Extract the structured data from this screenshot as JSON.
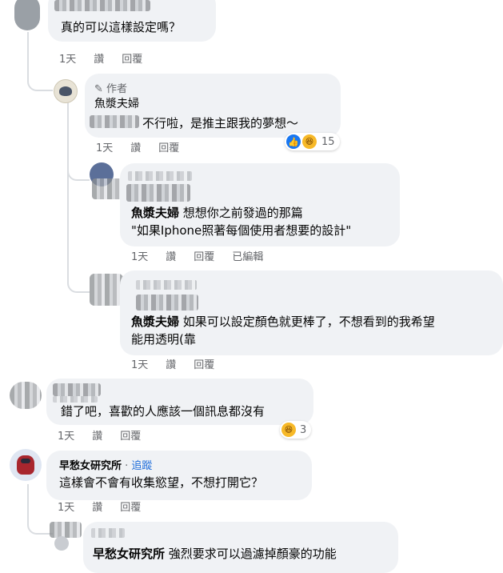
{
  "c1": {
    "text": "真的可以這樣設定嗎？",
    "meta": [
      "1天",
      "讚",
      "回覆"
    ]
  },
  "c2": {
    "badge": "作者",
    "name": "魚漿夫婦",
    "text": "不行啦，是推主跟我的夢想～",
    "meta": [
      "1天",
      "讚",
      "回覆"
    ],
    "reaction_count": "15"
  },
  "c3": {
    "mention": "魚漿夫婦",
    "text1": " 想想你之前發過的那篇",
    "text2": "\"如果Iphone照著每個使用者想要的設計\"",
    "meta": [
      "1天",
      "讚",
      "回覆",
      "已編輯"
    ]
  },
  "c4": {
    "mention": "魚漿夫婦",
    "text1": " 如果可以設定顏色就更棒了，不想看到的我希望",
    "text2": "能用透明(靠",
    "meta": [
      "1天",
      "讚",
      "回覆"
    ]
  },
  "c5": {
    "text": "錯了吧，喜歡的人應該一個訊息都沒有",
    "meta": [
      "1天",
      "讚",
      "回覆"
    ],
    "reaction_count": "3"
  },
  "c6": {
    "name": "早愁女研究所",
    "sep": " · ",
    "follow": "追蹤",
    "text": "這樣會不會有收集慾望，不想打開它？",
    "meta": [
      "1天",
      "讚",
      "回覆"
    ]
  },
  "c7": {
    "mention": "早愁女研究所",
    "text": " 強烈要求可以過濾掉顏豪的功能"
  },
  "colors": {
    "bubble": "#f0f2f5",
    "meta": "#65676b",
    "link": "#216fdb",
    "like": "#1877f2",
    "haha": "#f7b928"
  }
}
